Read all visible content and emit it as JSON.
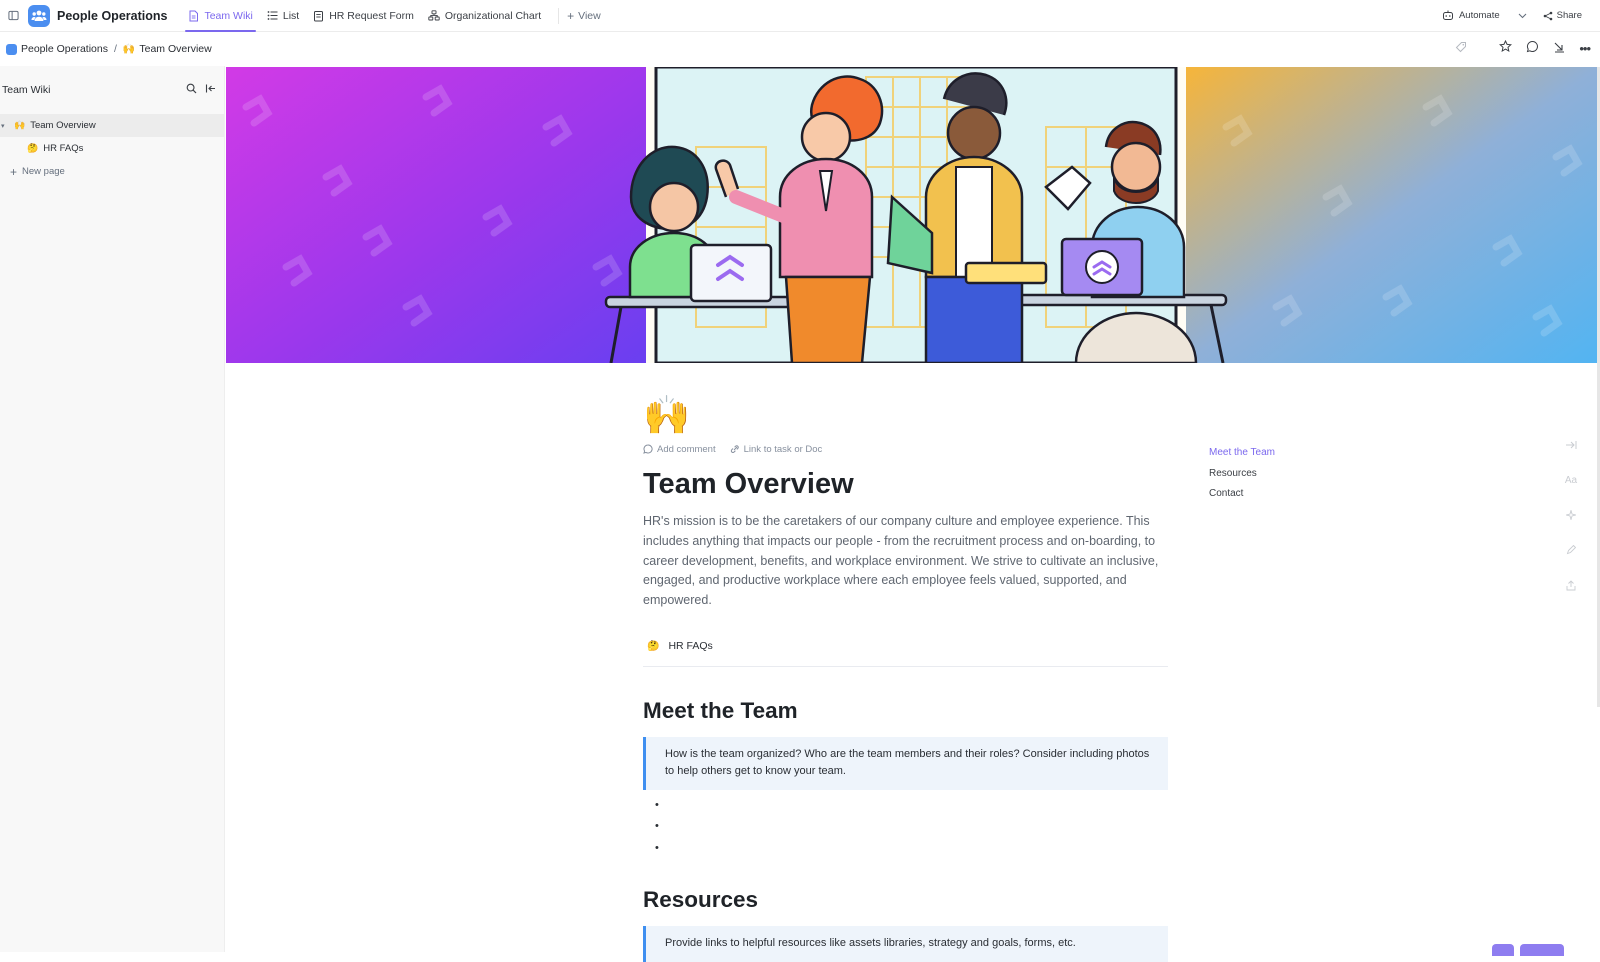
{
  "topbar": {
    "space_name": "People Operations",
    "tabs": [
      {
        "label": "Team Wiki",
        "icon": "doc-icon",
        "active": true
      },
      {
        "label": "List",
        "icon": "list-icon",
        "active": false
      },
      {
        "label": "HR Request Form",
        "icon": "form-icon",
        "active": false
      },
      {
        "label": "Organizational Chart",
        "icon": "chart-icon",
        "active": false
      }
    ],
    "add_view_label": "View",
    "automate_label": "Automate",
    "share_label": "Share"
  },
  "breadcrumb": {
    "space": "People Operations",
    "separator": "/",
    "page_emoji": "🙌",
    "page": "Team Overview"
  },
  "sidebar": {
    "title": "Team Wiki",
    "pages": [
      {
        "emoji": "🙌",
        "label": "Team Overview",
        "active": true
      },
      {
        "emoji": "🤔",
        "label": "HR FAQs",
        "active": false
      }
    ],
    "new_page_label": "New page"
  },
  "doc": {
    "emoji": "🙌",
    "add_comment_label": "Add comment",
    "link_label": "Link to task or Doc",
    "title": "Team Overview",
    "lead": "HR's mission is to be the caretakers of our company culture and employee experience. This includes anything that impacts our people - from the recruitment process and on-boarding, to career development, benefits, and workplace environment. We strive to cultivate an inclusive, engaged, and productive workplace where each employee feels valued, supported, and empowered.",
    "subpage_emoji": "🤔",
    "subpage_label": "HR FAQs",
    "meet_heading": "Meet the Team",
    "meet_callout": "How is the team organized? Who are the team members and their roles? Consider including photos to help others get to know your team.",
    "resources_heading": "Resources",
    "resources_callout": "Provide links to helpful resources like assets libraries, strategy and goals, forms, etc."
  },
  "toc": {
    "items": [
      "Meet the Team",
      "Resources",
      "Contact"
    ],
    "active_index": 0
  },
  "colors": {
    "accent": "#7b68ee",
    "callout_border": "#3f8ff0",
    "callout_bg": "#eef4fb",
    "banner_left": "#c935e8",
    "banner_right": "#5fb8f0"
  }
}
